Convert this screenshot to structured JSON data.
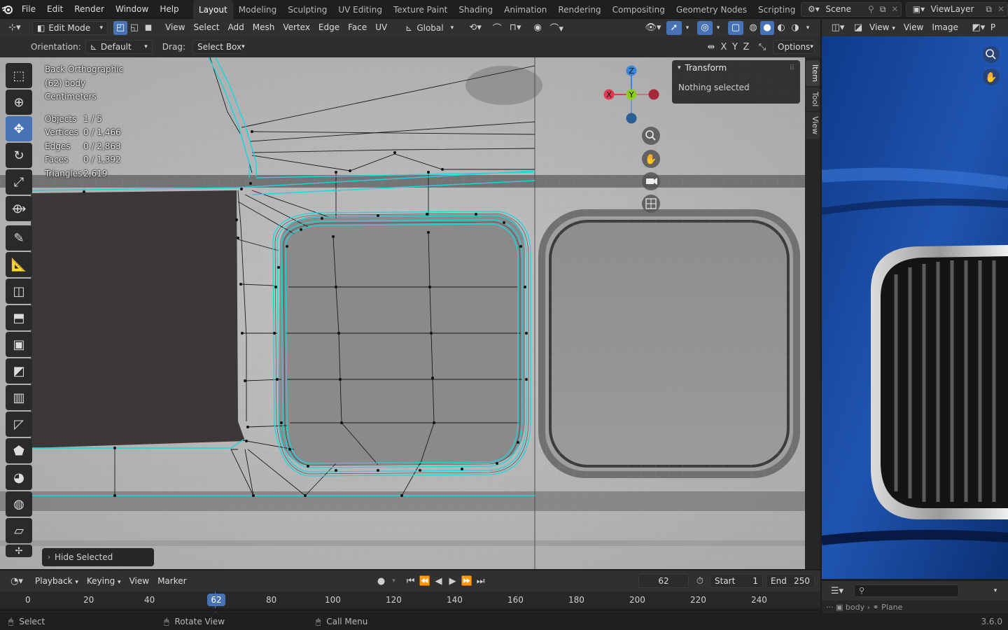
{
  "menu": {
    "items": [
      "File",
      "Edit",
      "Render",
      "Window",
      "Help"
    ],
    "workspaces": [
      "Layout",
      "Modeling",
      "Sculpting",
      "UV Editing",
      "Texture Paint",
      "Shading",
      "Animation",
      "Rendering",
      "Compositing",
      "Geometry Nodes",
      "Scripting"
    ],
    "active_workspace": "Layout",
    "scene": "Scene",
    "view_layer": "ViewLayer"
  },
  "viewport_header": {
    "mode": "Edit Mode",
    "menus": [
      "View",
      "Select",
      "Add",
      "Mesh",
      "Vertex",
      "Edge",
      "Face",
      "UV"
    ],
    "transform_orientation": "Global"
  },
  "tool_header": {
    "orientation_label": "Orientation:",
    "orientation_value": "Default",
    "drag_label": "Drag:",
    "drag_value": "Select Box",
    "axes": [
      "X",
      "Y",
      "Z"
    ],
    "options_label": "Options"
  },
  "overlay": {
    "view_name": "Back Orthographic",
    "object": "(62) body",
    "units": "Centimeters",
    "stats": [
      {
        "label": "Objects",
        "value": "1 / 5"
      },
      {
        "label": "Vertices",
        "value": "0 / 1,466"
      },
      {
        "label": "Edges",
        "value": "0 / 2,863"
      },
      {
        "label": "Faces",
        "value": "0 / 1,392"
      },
      {
        "label": "Triangles",
        "value": "2,619"
      }
    ]
  },
  "gizmo": {
    "x": "X",
    "y": "Y",
    "z": "Z"
  },
  "npanel": {
    "title": "Transform",
    "body": "Nothing selected",
    "tabs": [
      "Item",
      "Tool",
      "View"
    ]
  },
  "last_operator": "Hide Selected",
  "image_editor": {
    "menus": [
      "View",
      "View",
      "Image"
    ]
  },
  "timeline": {
    "menus": [
      "Playback",
      "Keying",
      "View",
      "Marker"
    ],
    "current_frame": "62",
    "start_label": "Start",
    "start": "1",
    "end_label": "End",
    "end": "250",
    "ticks": [
      "0",
      "20",
      "40",
      "80",
      "100",
      "120",
      "140",
      "160",
      "180",
      "200",
      "220",
      "240"
    ]
  },
  "statusbar": {
    "select": "Select",
    "rotate": "Rotate View",
    "call_menu": "Call Menu",
    "version": "3.6.0"
  },
  "colors": {
    "accent": "#4772b3",
    "mesh_edge": "#19d7e0",
    "current_frame": "#4772b3"
  }
}
